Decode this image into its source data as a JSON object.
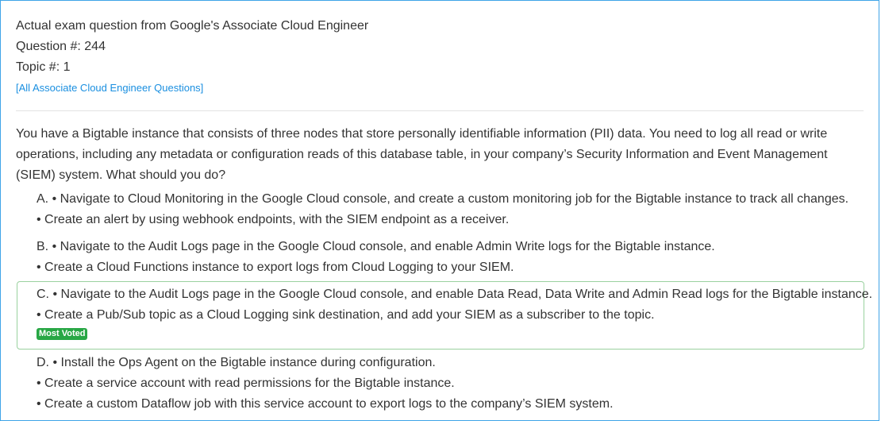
{
  "header": {
    "line1": "Actual exam question from Google's Associate Cloud Engineer",
    "question_no": "Question #: 244",
    "topic_no": "Topic #: 1",
    "all_link": "[All Associate Cloud Engineer Questions]"
  },
  "question_text": "You have a Bigtable instance that consists of three nodes that store personally identifiable information (PII) data. You need to log all read or write operations, including any metadata or configuration reads of this database table, in your company’s Security Information and Event Management (SIEM) system. What should you do?",
  "choices": [
    {
      "lines": [
        "A. • Navigate to Cloud Monitoring in the Google Cloud console, and create a custom monitoring job for the Bigtable instance to track all changes.",
        "• Create an alert by using webhook endpoints, with the SIEM endpoint as a receiver."
      ]
    },
    {
      "lines": [
        "B. • Navigate to the Audit Logs page in the Google Cloud console, and enable Admin Write logs for the Bigtable instance.",
        "• Create a Cloud Functions instance to export logs from Cloud Logging to your SIEM."
      ]
    },
    {
      "lines": [
        "C. • Navigate to the Audit Logs page in the Google Cloud console, and enable Data Read, Data Write and Admin Read logs for the Bigtable instance.",
        "• Create a Pub/Sub topic as a Cloud Logging sink destination, and add your SIEM as a subscriber to the topic."
      ],
      "badge": "Most Voted"
    },
    {
      "lines": [
        "D. • Install the Ops Agent on the Bigtable instance during configuration.",
        "• Create a service account with read permissions for the Bigtable instance.",
        "• Create a custom Dataflow job with this service account to export logs to the company’s SIEM system."
      ]
    }
  ],
  "colors": {
    "frame_border": "#3fa4e8",
    "link": "#1a8fe0",
    "badge_bg": "#28a745",
    "voted_border": "#9ad19f"
  }
}
